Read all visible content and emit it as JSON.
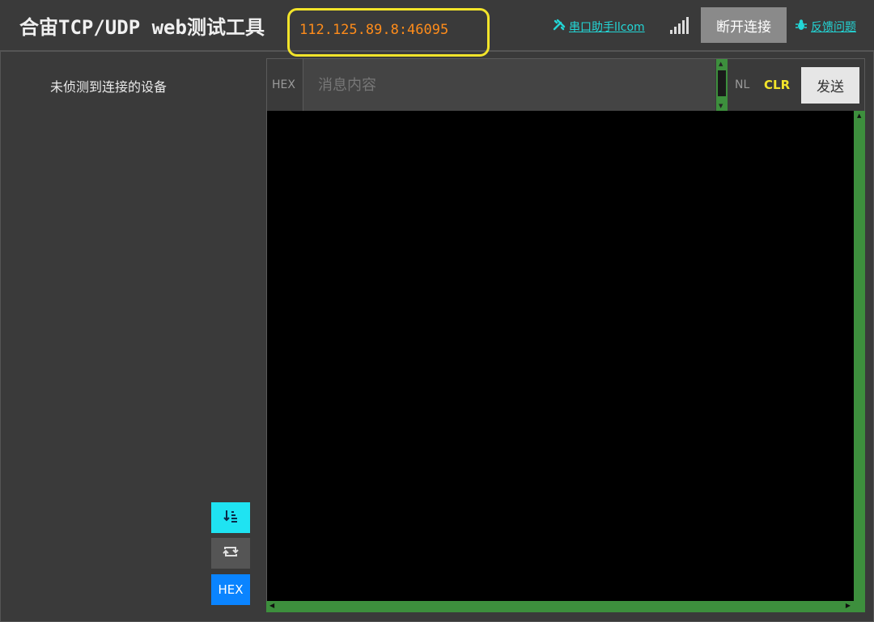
{
  "header": {
    "title": "合宙TCP/UDP web测试工具",
    "address": "112.125.89.8:46095",
    "serial_link": "串口助手llcom",
    "disconnect_label": "断开连接",
    "feedback_link": "反馈问题"
  },
  "device_panel": {
    "status_text": "未侦测到连接的设备",
    "buttons": {
      "sort_icon": "sort-down-icon",
      "loop_icon": "repeat-icon",
      "hex_label": "HEX"
    }
  },
  "send_bar": {
    "hex_label": "HEX",
    "message_placeholder": "消息内容",
    "message_value": "",
    "nl_label": "NL",
    "clr_label": "CLR",
    "send_label": "发送"
  },
  "colors": {
    "address_highlight": "#f2e42a",
    "address_text": "#ff8c1a",
    "link": "#23d6d6",
    "scrollbar": "#3d8f3d",
    "hex_active": "#0a84ff",
    "sort_active": "#1fe3f2"
  },
  "output": {
    "lines": []
  }
}
